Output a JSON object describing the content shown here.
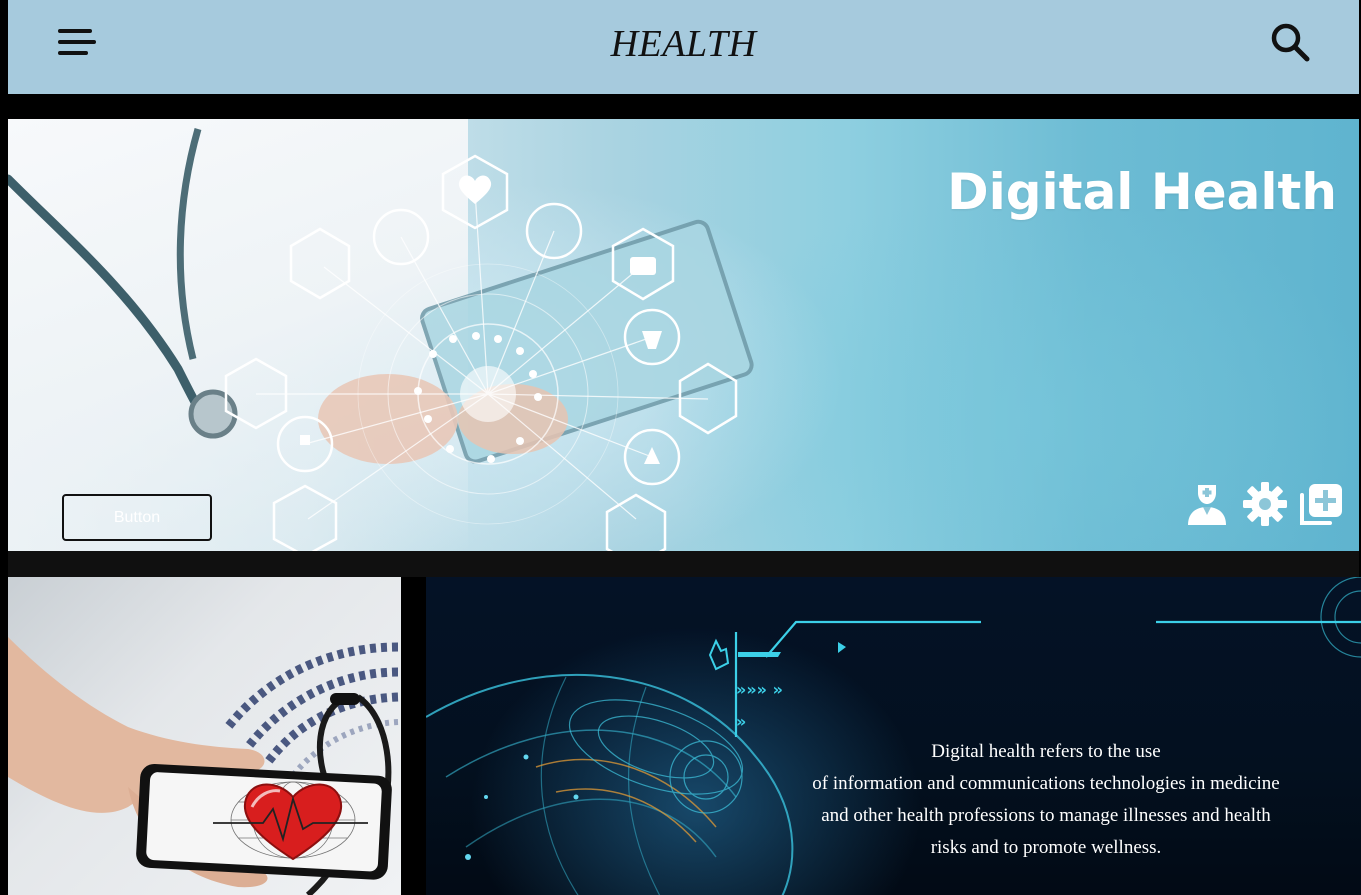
{
  "header": {
    "title": "HEALTH",
    "menu_icon": "hamburger-menu-icon",
    "search_icon": "search-icon",
    "background": "#a6cadd"
  },
  "hero": {
    "title": "Digital Health",
    "button_label": "Button",
    "icons": [
      "doctor-icon",
      "gear-icon",
      "add-item-icon"
    ]
  },
  "info": {
    "lines": [
      "Digital health refers to the use",
      "of information and communications technologies in medicine",
      "and other health professions to manage illnesses and health",
      "risks and to promote wellness."
    ]
  },
  "colors": {
    "page_background": "#000000",
    "header_background": "#a6cadd",
    "hero_text": "#ffffff",
    "info_text": "#ffffff"
  }
}
